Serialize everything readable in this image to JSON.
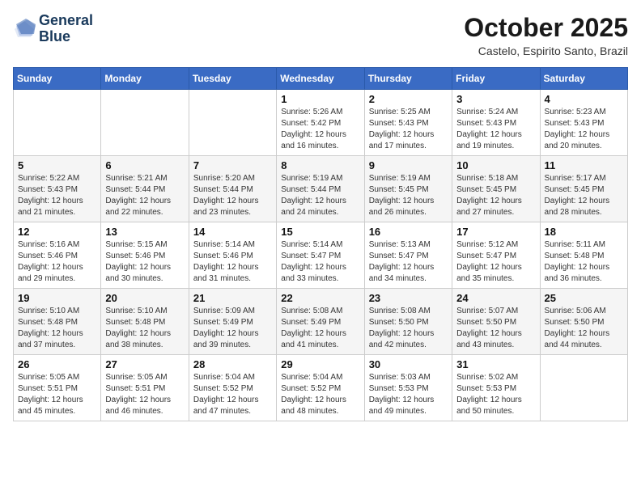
{
  "header": {
    "logo_line1": "General",
    "logo_line2": "Blue",
    "month": "October 2025",
    "location": "Castelo, Espirito Santo, Brazil"
  },
  "weekdays": [
    "Sunday",
    "Monday",
    "Tuesday",
    "Wednesday",
    "Thursday",
    "Friday",
    "Saturday"
  ],
  "weeks": [
    [
      {
        "day": "",
        "info": ""
      },
      {
        "day": "",
        "info": ""
      },
      {
        "day": "",
        "info": ""
      },
      {
        "day": "1",
        "info": "Sunrise: 5:26 AM\nSunset: 5:42 PM\nDaylight: 12 hours and 16 minutes."
      },
      {
        "day": "2",
        "info": "Sunrise: 5:25 AM\nSunset: 5:43 PM\nDaylight: 12 hours and 17 minutes."
      },
      {
        "day": "3",
        "info": "Sunrise: 5:24 AM\nSunset: 5:43 PM\nDaylight: 12 hours and 19 minutes."
      },
      {
        "day": "4",
        "info": "Sunrise: 5:23 AM\nSunset: 5:43 PM\nDaylight: 12 hours and 20 minutes."
      }
    ],
    [
      {
        "day": "5",
        "info": "Sunrise: 5:22 AM\nSunset: 5:43 PM\nDaylight: 12 hours and 21 minutes."
      },
      {
        "day": "6",
        "info": "Sunrise: 5:21 AM\nSunset: 5:44 PM\nDaylight: 12 hours and 22 minutes."
      },
      {
        "day": "7",
        "info": "Sunrise: 5:20 AM\nSunset: 5:44 PM\nDaylight: 12 hours and 23 minutes."
      },
      {
        "day": "8",
        "info": "Sunrise: 5:19 AM\nSunset: 5:44 PM\nDaylight: 12 hours and 24 minutes."
      },
      {
        "day": "9",
        "info": "Sunrise: 5:19 AM\nSunset: 5:45 PM\nDaylight: 12 hours and 26 minutes."
      },
      {
        "day": "10",
        "info": "Sunrise: 5:18 AM\nSunset: 5:45 PM\nDaylight: 12 hours and 27 minutes."
      },
      {
        "day": "11",
        "info": "Sunrise: 5:17 AM\nSunset: 5:45 PM\nDaylight: 12 hours and 28 minutes."
      }
    ],
    [
      {
        "day": "12",
        "info": "Sunrise: 5:16 AM\nSunset: 5:46 PM\nDaylight: 12 hours and 29 minutes."
      },
      {
        "day": "13",
        "info": "Sunrise: 5:15 AM\nSunset: 5:46 PM\nDaylight: 12 hours and 30 minutes."
      },
      {
        "day": "14",
        "info": "Sunrise: 5:14 AM\nSunset: 5:46 PM\nDaylight: 12 hours and 31 minutes."
      },
      {
        "day": "15",
        "info": "Sunrise: 5:14 AM\nSunset: 5:47 PM\nDaylight: 12 hours and 33 minutes."
      },
      {
        "day": "16",
        "info": "Sunrise: 5:13 AM\nSunset: 5:47 PM\nDaylight: 12 hours and 34 minutes."
      },
      {
        "day": "17",
        "info": "Sunrise: 5:12 AM\nSunset: 5:47 PM\nDaylight: 12 hours and 35 minutes."
      },
      {
        "day": "18",
        "info": "Sunrise: 5:11 AM\nSunset: 5:48 PM\nDaylight: 12 hours and 36 minutes."
      }
    ],
    [
      {
        "day": "19",
        "info": "Sunrise: 5:10 AM\nSunset: 5:48 PM\nDaylight: 12 hours and 37 minutes."
      },
      {
        "day": "20",
        "info": "Sunrise: 5:10 AM\nSunset: 5:48 PM\nDaylight: 12 hours and 38 minutes."
      },
      {
        "day": "21",
        "info": "Sunrise: 5:09 AM\nSunset: 5:49 PM\nDaylight: 12 hours and 39 minutes."
      },
      {
        "day": "22",
        "info": "Sunrise: 5:08 AM\nSunset: 5:49 PM\nDaylight: 12 hours and 41 minutes."
      },
      {
        "day": "23",
        "info": "Sunrise: 5:08 AM\nSunset: 5:50 PM\nDaylight: 12 hours and 42 minutes."
      },
      {
        "day": "24",
        "info": "Sunrise: 5:07 AM\nSunset: 5:50 PM\nDaylight: 12 hours and 43 minutes."
      },
      {
        "day": "25",
        "info": "Sunrise: 5:06 AM\nSunset: 5:50 PM\nDaylight: 12 hours and 44 minutes."
      }
    ],
    [
      {
        "day": "26",
        "info": "Sunrise: 5:05 AM\nSunset: 5:51 PM\nDaylight: 12 hours and 45 minutes."
      },
      {
        "day": "27",
        "info": "Sunrise: 5:05 AM\nSunset: 5:51 PM\nDaylight: 12 hours and 46 minutes."
      },
      {
        "day": "28",
        "info": "Sunrise: 5:04 AM\nSunset: 5:52 PM\nDaylight: 12 hours and 47 minutes."
      },
      {
        "day": "29",
        "info": "Sunrise: 5:04 AM\nSunset: 5:52 PM\nDaylight: 12 hours and 48 minutes."
      },
      {
        "day": "30",
        "info": "Sunrise: 5:03 AM\nSunset: 5:53 PM\nDaylight: 12 hours and 49 minutes."
      },
      {
        "day": "31",
        "info": "Sunrise: 5:02 AM\nSunset: 5:53 PM\nDaylight: 12 hours and 50 minutes."
      },
      {
        "day": "",
        "info": ""
      }
    ]
  ]
}
